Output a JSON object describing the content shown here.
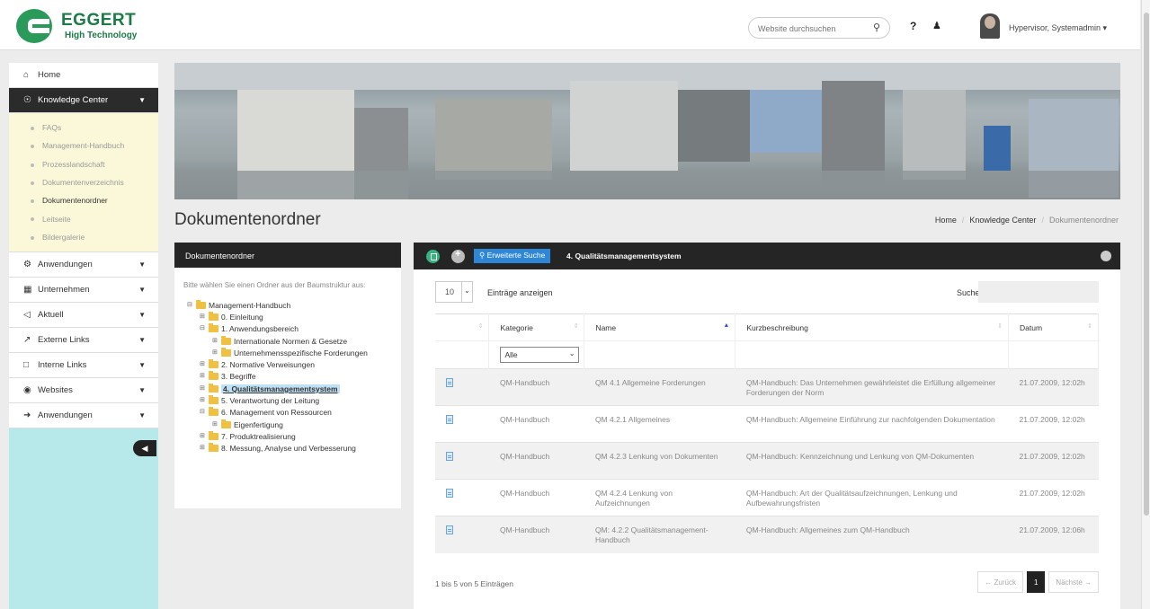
{
  "brand": {
    "name": "EGGERT",
    "tagline": "High Technology"
  },
  "header": {
    "search_placeholder": "Website durchsuchen",
    "help": "?",
    "user_name": "Hypervisor, Systemadmin ▾"
  },
  "sidebar": {
    "items": [
      {
        "label": "Home",
        "icon": "home-icon"
      },
      {
        "label": "Knowledge Center",
        "icon": "bulb-icon"
      },
      {
        "label": "Anwendungen",
        "icon": "cogs-icon"
      },
      {
        "label": "Unternehmen",
        "icon": "building-icon"
      },
      {
        "label": "Aktuell",
        "icon": "bullhorn-icon"
      },
      {
        "label": "Externe Links",
        "icon": "external-link-icon"
      },
      {
        "label": "Interne Links",
        "icon": "bookmark-icon"
      },
      {
        "label": "Websites",
        "icon": "globe-icon"
      },
      {
        "label": "Anwendungen",
        "icon": "signin-icon"
      }
    ],
    "subitems": [
      "FAQs",
      "Management-Handbuch",
      "Prozesslandschaft",
      "Dokumentenverzeichnis",
      "Dokumentenordner",
      "Leitseite",
      "Bildergalerie"
    ]
  },
  "page": {
    "title": "Dokumentenordner"
  },
  "breadcrumb": [
    "Home",
    "Knowledge Center",
    "Dokumentenordner"
  ],
  "tree_panel": {
    "title": "Dokumentenordner",
    "intro": "Bitte wählen Sie einen Ordner aus der Baumstruktur aus:",
    "nodes": [
      "Management-Handbuch",
      "0. Einleitung",
      "1. Anwendungsbereich",
      "Internationale Normen & Gesetze",
      "Unternehmensspezifische Forderungen",
      "2. Normative Verweisungen",
      "3. Begriffe",
      "4. Qualitätsmanagementsystem",
      "5. Verantwortung der Leitung",
      "6. Management von Ressourcen",
      "Eigenfertigung",
      "7. Produktrealisierung",
      "8. Messung, Analyse und Verbesserung"
    ]
  },
  "docs_panel": {
    "adv_search": "Erweiterte Suche",
    "title": "4. Qualitätsmanagementsystem",
    "length_value": "10",
    "length_label": "Einträge anzeigen",
    "search_label": "Suchen",
    "columns": [
      "Kategorie",
      "Name",
      "Kurzbeschreibung",
      "Datum"
    ],
    "filter_value": "Alle",
    "rows": [
      {
        "cat": "QM-Handbuch",
        "name": "QM 4.1 Allgemeine Forderungen",
        "desc": "QM-Handbuch: Das Unternehmen gewährleistet die Erfüllung allgemeiner Forderungen der Norm",
        "date": "21.07.2009, 12:02h"
      },
      {
        "cat": "QM-Handbuch",
        "name": "QM 4.2.1 Allgemeines",
        "desc": "QM-Handbuch: Allgemeine Einführung zur nachfolgenden Dokumentation",
        "date": "21.07.2009, 12:02h"
      },
      {
        "cat": "QM-Handbuch",
        "name": "QM 4.2.3 Lenkung von Dokumenten",
        "desc": "QM-Handbuch: Kennzeichnung und Lenkung von QM-Dokumenten",
        "date": "21.07.2009, 12:02h"
      },
      {
        "cat": "QM-Handbuch",
        "name": "QM 4.2.4 Lenkung von Aufzeichnungen",
        "desc": "QM-Handbuch: Art der Qualitätsaufzeichnungen, Lenkung und Aufbewahrungsfristen",
        "date": "21.07.2009, 12:02h"
      },
      {
        "cat": "QM-Handbuch",
        "name": "QM: 4.2.2 Qualitätsmanagement-Handbuch",
        "desc": "QM-Handbuch: Allgemeines zum QM-Handbuch",
        "date": "21.07.2009, 12:06h"
      }
    ],
    "info": "1 bis 5 von 5 Einträgen",
    "pager": {
      "prev": "← Zurück",
      "current": "1",
      "next": "Nächste →"
    }
  }
}
